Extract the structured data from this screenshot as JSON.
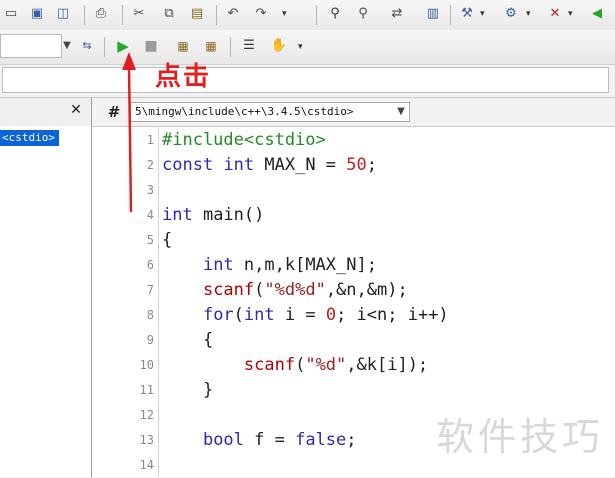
{
  "toolbar_icons_row1": [
    "document-icon",
    "save-icon",
    "save-all-icon",
    "print-icon",
    "cut-icon",
    "copy-icon",
    "paste-icon",
    "undo-icon",
    "redo-icon",
    "find-icon",
    "find-next-icon",
    "replace-icon",
    "bookmark-icon",
    "compile-icon",
    "build-icon",
    "stop-build-icon",
    "arrow-icon"
  ],
  "toolbar_icons_row2": [
    "goto-icon",
    "run-icon",
    "stop-icon",
    "debug-icon",
    "debug2-icon",
    "list-icon",
    "hand-icon"
  ],
  "sidebar": {
    "close_label": "✕",
    "item_label": "<cstdio>"
  },
  "editor": {
    "tab_pin": "#",
    "path": "5\\mingw\\include\\c++\\3.4.5\\cstdio>"
  },
  "annotation": "点击",
  "watermark": "软件技巧",
  "code_lines": [
    {
      "n": "1",
      "text": "#include<cstdio>"
    },
    {
      "n": "2",
      "text": "const int MAX_N = 50;"
    },
    {
      "n": "3",
      "text": ""
    },
    {
      "n": "4",
      "text": "int main()"
    },
    {
      "n": "5",
      "text": "{"
    },
    {
      "n": "6",
      "text": "    int n,m,k[MAX_N];"
    },
    {
      "n": "7",
      "text": "    scanf(\"%d%d\",&n,&m);"
    },
    {
      "n": "8",
      "text": "    for(int i = 0; i<n; i++)"
    },
    {
      "n": "9",
      "text": "    {"
    },
    {
      "n": "10",
      "text": "        scanf(\"%d\",&k[i]);"
    },
    {
      "n": "11",
      "text": "    }"
    },
    {
      "n": "12",
      "text": ""
    },
    {
      "n": "13",
      "text": "    bool f = false;"
    },
    {
      "n": "14",
      "text": ""
    }
  ],
  "colors": {
    "selection_blue": "#0a64d8",
    "annotation_red": "#e02020",
    "run_green": "#27a627"
  }
}
